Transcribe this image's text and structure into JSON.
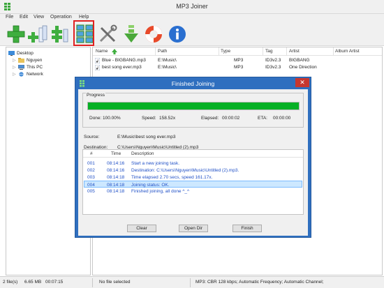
{
  "window": {
    "title": "MP3 Joiner"
  },
  "menu": [
    "File",
    "Edit",
    "View",
    "Operation",
    "Help"
  ],
  "tree": {
    "root": "Desktop",
    "children": [
      "Nguyen",
      "This PC",
      "Network"
    ]
  },
  "filelist": {
    "columns": [
      "Name",
      "Path",
      "Type",
      "Tag",
      "Artist",
      "Album Artist"
    ],
    "rows": [
      {
        "name": "Blue - BIGBANG.mp3",
        "path": "E:\\Music\\",
        "type": "MP3",
        "tag": "ID3v2.3",
        "artist": "BIGBANG",
        "album_artist": ""
      },
      {
        "name": "best song ever.mp3",
        "path": "E:\\Music\\",
        "type": "MP3",
        "tag": "ID3v2.3",
        "artist": "One Direction",
        "album_artist": ""
      }
    ]
  },
  "dialog": {
    "title": "Finished Joining",
    "progress_legend": "Progress",
    "progress_fraction": 1.0,
    "done_label": "Done:",
    "done_value": "100.00%",
    "speed_label": "Speed:",
    "speed_value": "158.52x",
    "elapsed_label": "Elapsed:",
    "elapsed_value": "00:00:02",
    "eta_label": "ETA:",
    "eta_value": "00:00:00",
    "source_label": "Source:",
    "source_value": "E:\\Music\\best song ever.mp3",
    "dest_label": "Destination:",
    "dest_value": "C:\\Users\\Nguyen\\Music\\Untitled (2).mp3",
    "log_columns": [
      "#",
      "Time",
      "Description"
    ],
    "log": [
      {
        "num": "001",
        "time": "08:14:16",
        "desc": "Start a new joining task."
      },
      {
        "num": "002",
        "time": "08:14:16",
        "desc": "Destination: C:\\Users\\Nguyen\\Music\\Untitled (2).mp3."
      },
      {
        "num": "003",
        "time": "08:14:18",
        "desc": "Time elapsed 2.70 secs, speed 161.17x."
      },
      {
        "num": "004",
        "time": "08:14:18",
        "desc": "Joining status: OK."
      },
      {
        "num": "005",
        "time": "08:14:18",
        "desc": "Finished joining, all done ^_^"
      }
    ],
    "selected_log_index": 3,
    "buttons": {
      "clear": "Clear",
      "open_dir": "Open Dir",
      "finish": "Finish"
    },
    "close_glyph": "✕"
  },
  "status": {
    "files": "2 file(s)",
    "size": "6.65 MB",
    "duration": "00:07:15",
    "selection": "No file selected",
    "format": "MP3:  CBR 128 kbps; Automatic Frequency; Automatic Channel;"
  },
  "colors": {
    "accent": "#2f6fbf",
    "progress": "#06b025",
    "log_text": "#1f4fc6",
    "highlight": "#e02020"
  }
}
